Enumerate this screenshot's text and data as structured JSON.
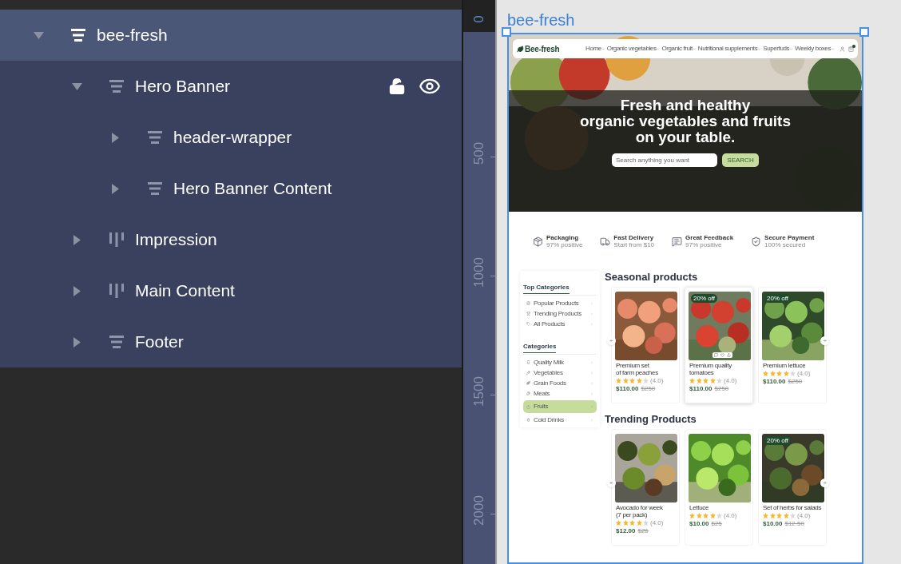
{
  "layers": [
    {
      "label": "bee-fresh",
      "kind": "stack",
      "expanded": true,
      "selected": true,
      "hovered": false,
      "children": [
        {
          "label": "Hero Banner",
          "kind": "stack",
          "expanded": true,
          "selected": false,
          "hovered": true,
          "children": [
            {
              "label": "header-wrapper",
              "kind": "stack",
              "expanded": false,
              "selected": false,
              "hovered": false
            },
            {
              "label": "Hero Banner Content",
              "kind": "stack",
              "expanded": false,
              "selected": false,
              "hovered": false
            }
          ]
        },
        {
          "label": "Impression",
          "kind": "columns",
          "expanded": false,
          "selected": false,
          "hovered": false
        },
        {
          "label": "Main Content",
          "kind": "columns",
          "expanded": false,
          "selected": false,
          "hovered": false
        },
        {
          "label": "Footer",
          "kind": "stack",
          "expanded": false,
          "selected": false,
          "hovered": false
        }
      ]
    }
  ],
  "ruler": [
    "0",
    "500",
    "1000",
    "1500",
    "2000"
  ],
  "frame": {
    "title": "bee-fresh",
    "site": {
      "logo": "Bee-fresh",
      "nav": [
        "Home",
        "Organic vegetables",
        "Organic fruit",
        "Nutritional supplements",
        "Superfuds",
        "Weekly boxes"
      ],
      "hero": {
        "title": "Fresh and healthy\norganic vegetables and fruits\non your table.",
        "search": {
          "placeholder": "Search anything you want"
        },
        "button": "SEARCH"
      },
      "features": [
        {
          "kind": "package",
          "title": "Packaging",
          "subtitle": "97% positive"
        },
        {
          "kind": "truck",
          "title": "Fast Delivery",
          "subtitle": "Start from $10"
        },
        {
          "kind": "feedback",
          "title": "Great Feedback",
          "subtitle": "97% positive"
        },
        {
          "kind": "payment",
          "title": "Secure Payment",
          "subtitle": "100% secured"
        }
      ],
      "sidebar": {
        "groups": [
          {
            "title": "Top Categories",
            "items": [
              {
                "label": "Popular Products",
                "kind": "file",
                "selected": false
              },
              {
                "label": "Trending Products",
                "kind": "trophy",
                "selected": false
              },
              {
                "label": "All Products",
                "kind": "tag",
                "selected": false
              }
            ]
          },
          {
            "title": "Categories",
            "items": [
              {
                "label": "Quality Milk",
                "kind": "milk",
                "selected": false
              },
              {
                "label": "Vegetables",
                "kind": "carrot",
                "selected": false
              },
              {
                "label": "Grain Foods",
                "kind": "wheat",
                "selected": false
              },
              {
                "label": "Meats",
                "kind": "beef",
                "selected": false
              },
              {
                "label": "Fruits",
                "kind": "apple",
                "selected": true
              },
              {
                "label": "Cold Drinks",
                "kind": "cup",
                "selected": false
              }
            ]
          }
        ]
      },
      "sections": [
        {
          "title": "Seasonal products",
          "products": [
            {
              "name": "Premium set\nof farm peaches",
              "hovered": false,
              "stars": 4,
              "rating": "(4.0)",
              "price": "$110.00",
              "old_price": "$250"
            },
            {
              "name": "Premium quality\ntomatoes",
              "badge": "20% off",
              "hovered": true,
              "stars": 4,
              "rating": "(4.0)",
              "price": "$110.00",
              "old_price": "$250"
            },
            {
              "name": "Premium lettuce",
              "badge": "20% off",
              "hovered": false,
              "stars": 4,
              "rating": "(4.0)",
              "price": "$110.00",
              "old_price": "$250"
            }
          ]
        },
        {
          "title": "Trending Products",
          "products": [
            {
              "name": "Avocado for week\n(7 per pack)",
              "hovered": false,
              "stars": 4,
              "rating": "(4.0)",
              "price": "$12.00",
              "old_price": "$26"
            },
            {
              "name": "Lettuce",
              "hovered": false,
              "stars": 4,
              "rating": "(4.0)",
              "price": "$10.00",
              "old_price": "$25"
            },
            {
              "name": "Set of herbs for salads",
              "badge": "20% off",
              "hovered": false,
              "stars": 4,
              "rating": "(4.0)",
              "price": "$10.00",
              "old_price": "$12.50"
            }
          ]
        }
      ]
    }
  }
}
